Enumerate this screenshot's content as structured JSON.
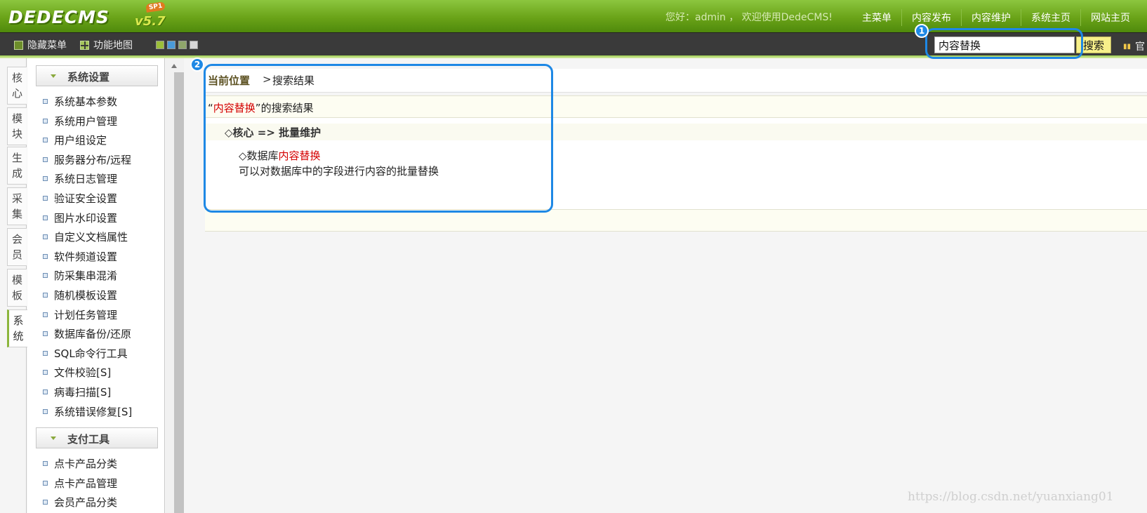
{
  "header": {
    "logo_text": "DEDECMS",
    "logo_version": "v5.7",
    "logo_sp": "SP1",
    "welcome": "您好：admin ， 欢迎使用DedeCMS!",
    "nav": [
      "主菜单",
      "内容发布",
      "内容维护",
      "系统主页",
      "网站主页"
    ]
  },
  "toolbar": {
    "hide_menu": "隐藏菜单",
    "function_map": "功能地图",
    "skin_colors": [
      "#9cbf3a",
      "#4a9ad8",
      "#8fa56b",
      "#d6d6d6"
    ],
    "search_value": "内容替换",
    "search_button": "搜索",
    "right_text": "官"
  },
  "vtabs": [
    {
      "label": "核心",
      "active": false
    },
    {
      "label": "模块",
      "active": false
    },
    {
      "label": "生成",
      "active": false
    },
    {
      "label": "采集",
      "active": false
    },
    {
      "label": "会员",
      "active": false
    },
    {
      "label": "模板",
      "active": false
    },
    {
      "label": "系统",
      "active": true
    }
  ],
  "sidebar": {
    "sections": [
      {
        "title": "系统设置",
        "items": [
          "系统基本参数",
          "系统用户管理",
          "用户组设定",
          "服务器分布/远程",
          "系统日志管理",
          "验证安全设置",
          "图片水印设置",
          "自定义文档属性",
          "软件频道设置",
          "防采集串混淆",
          "随机模板设置",
          "计划任务管理",
          "数据库备份/还原",
          "SQL命令行工具",
          "文件校验[S]",
          "病毒扫描[S]",
          "系统错误修复[S]"
        ]
      },
      {
        "title": "支付工具",
        "items": [
          "点卡产品分类",
          "点卡产品管理",
          "会员产品分类"
        ]
      }
    ]
  },
  "main": {
    "breadcrumb_current": "当前位置",
    "breadcrumb_sep": ">",
    "breadcrumb_page": "搜索结果",
    "result_open_quote": "“",
    "result_keyword": "内容替换",
    "result_suffix": "”的搜索结果",
    "category": "◇核心 => 批量维护",
    "item_prefix": "◇数据库",
    "item_keyword": "内容替换",
    "item_desc": "可以对数据库中的字段进行内容的批量替换"
  },
  "annotations": {
    "badge_1": "1",
    "badge_2": "2",
    "highlight_color": "#1e88e5"
  },
  "watermark": "https://blog.csdn.net/yuanxiang01"
}
